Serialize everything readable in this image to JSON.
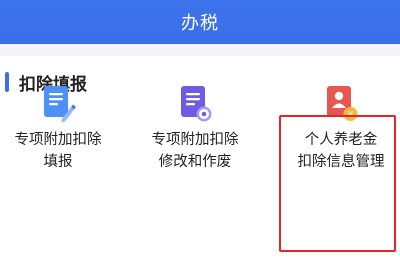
{
  "header": {
    "title": "办税"
  },
  "section": {
    "title": "扣除填报"
  },
  "items": [
    {
      "label_line1": "专项附加扣除",
      "label_line2": "填报",
      "icon": "edit-document-icon",
      "color": "#4b8ff5"
    },
    {
      "label_line1": "专项附加扣除",
      "label_line2": "修改和作废",
      "icon": "document-settings-icon",
      "color": "#6f5ce6"
    },
    {
      "label_line1": "个人养老金",
      "label_line2": "扣除信息管理",
      "icon": "pension-profile-icon",
      "color": "#e8574f"
    }
  ],
  "colors": {
    "header_bg": "#3a6fe9",
    "accent_bar": "#3c6ff0",
    "highlight_border": "#e5252a",
    "badge_yellow": "#f5b83d"
  }
}
